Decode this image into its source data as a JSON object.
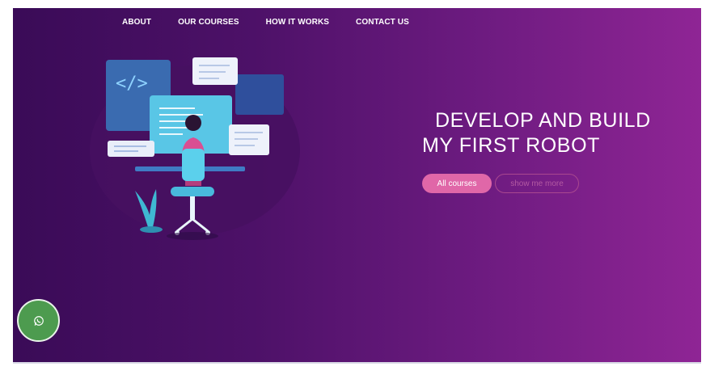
{
  "nav": {
    "items": [
      {
        "label": "ABOUT"
      },
      {
        "label": "OUR COURSES"
      },
      {
        "label": "HOW IT WORKS"
      },
      {
        "label": "CONTACT US"
      }
    ]
  },
  "hero": {
    "headline_line1": "DEVELOP AND BUILD",
    "headline_line2": "MY FIRST ROBOT",
    "primary_button": "All courses",
    "secondary_button": "show me more",
    "code_symbol": "</>"
  },
  "floating": {
    "whatsapp_icon": "whatsapp-icon"
  },
  "colors": {
    "gradient_start": "#3a0b57",
    "gradient_end": "#8f2595",
    "primary_button": "#e067a8",
    "whatsapp": "#4d9b4f"
  }
}
